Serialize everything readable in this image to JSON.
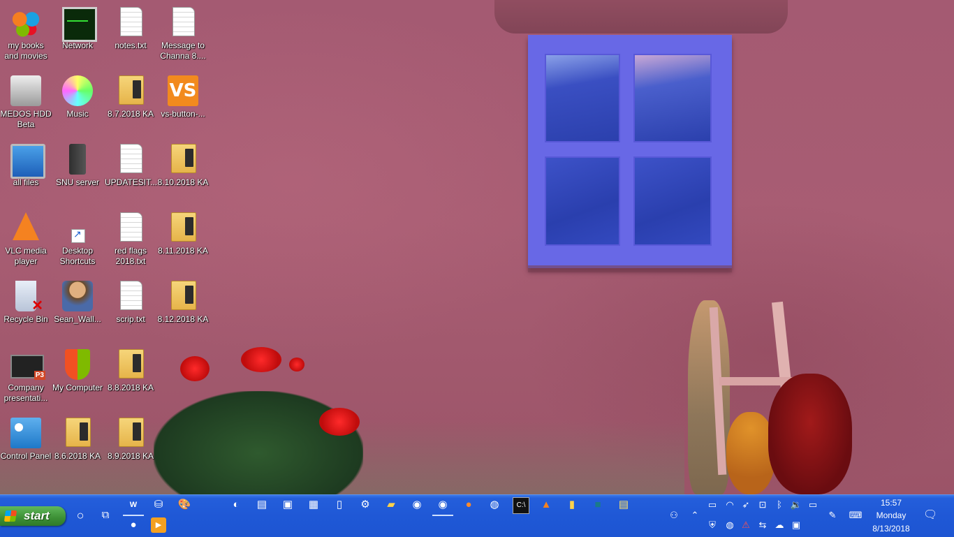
{
  "desktop": {
    "icons": [
      {
        "label": "my books and movies",
        "icon": "butterfly-icon"
      },
      {
        "label": "Network",
        "icon": "network-monitor-icon"
      },
      {
        "label": "notes.txt",
        "icon": "text-file-icon"
      },
      {
        "label": "Message to Channa 8....",
        "icon": "text-file-icon"
      },
      {
        "label": "MEDOS HDD Beta",
        "icon": "hard-drive-icon"
      },
      {
        "label": "Music",
        "icon": "music-cd-icon"
      },
      {
        "label": "8.7.2018 KA",
        "icon": "folder-icon"
      },
      {
        "label": "vs-button-...",
        "icon": "vs-icon"
      },
      {
        "label": "all files",
        "icon": "computer-icon"
      },
      {
        "label": "SNU server",
        "icon": "server-icon"
      },
      {
        "label": "UPDATESIT...",
        "icon": "text-file-icon"
      },
      {
        "label": "8.10.2018 KA",
        "icon": "folder-icon"
      },
      {
        "label": "VLC media player",
        "icon": "vlc-icon"
      },
      {
        "label": "Desktop Shortcuts",
        "icon": "shortcut-icon"
      },
      {
        "label": "red flags 2018.txt",
        "icon": "text-file-icon"
      },
      {
        "label": "8.11.2018 KA",
        "icon": "folder-icon"
      },
      {
        "label": "Recycle Bin",
        "icon": "recycle-bin-icon"
      },
      {
        "label": "Sean_Wall...",
        "icon": "user-icon"
      },
      {
        "label": "scrip.txt",
        "icon": "text-file-icon"
      },
      {
        "label": "8.12.2018 KA",
        "icon": "folder-icon"
      },
      {
        "label": "Company presentati...",
        "icon": "powerpoint-icon"
      },
      {
        "label": "My Computer",
        "icon": "windows-shield-icon"
      },
      {
        "label": "8.8.2018 KA",
        "icon": "folder-icon"
      },
      {
        "label": "Control Panel",
        "icon": "control-panel-icon"
      },
      {
        "label": "8.6.2018 KA",
        "icon": "folder-icon"
      },
      {
        "label": "8.9.2018 KA",
        "icon": "folder-icon"
      }
    ]
  },
  "taskbar": {
    "start_label": "start",
    "clock_time": "15:57",
    "clock_day": "Monday",
    "clock_date": "8/13/2018",
    "pinned": [
      "cortana-circle-icon",
      "task-view-icon",
      "word-icon",
      "network-drive-icon",
      "paint-icon",
      "eraser-icon",
      "archive-icon",
      "image-viewer-icon",
      "calculator-icon",
      "notepad-icon",
      "settings-gear-icon",
      "file-explorer-icon",
      "chrome-icon",
      "chrome-active-icon",
      "firefox-icon",
      "discord-icon",
      "cmd-icon",
      "vlc-taskbar-icon",
      "folder-alt-icon",
      "book-icon",
      "sticky-notes-icon"
    ],
    "colors": {
      "taskbar_blue": "#1f58d6",
      "start_green": "#3c8f35"
    }
  }
}
